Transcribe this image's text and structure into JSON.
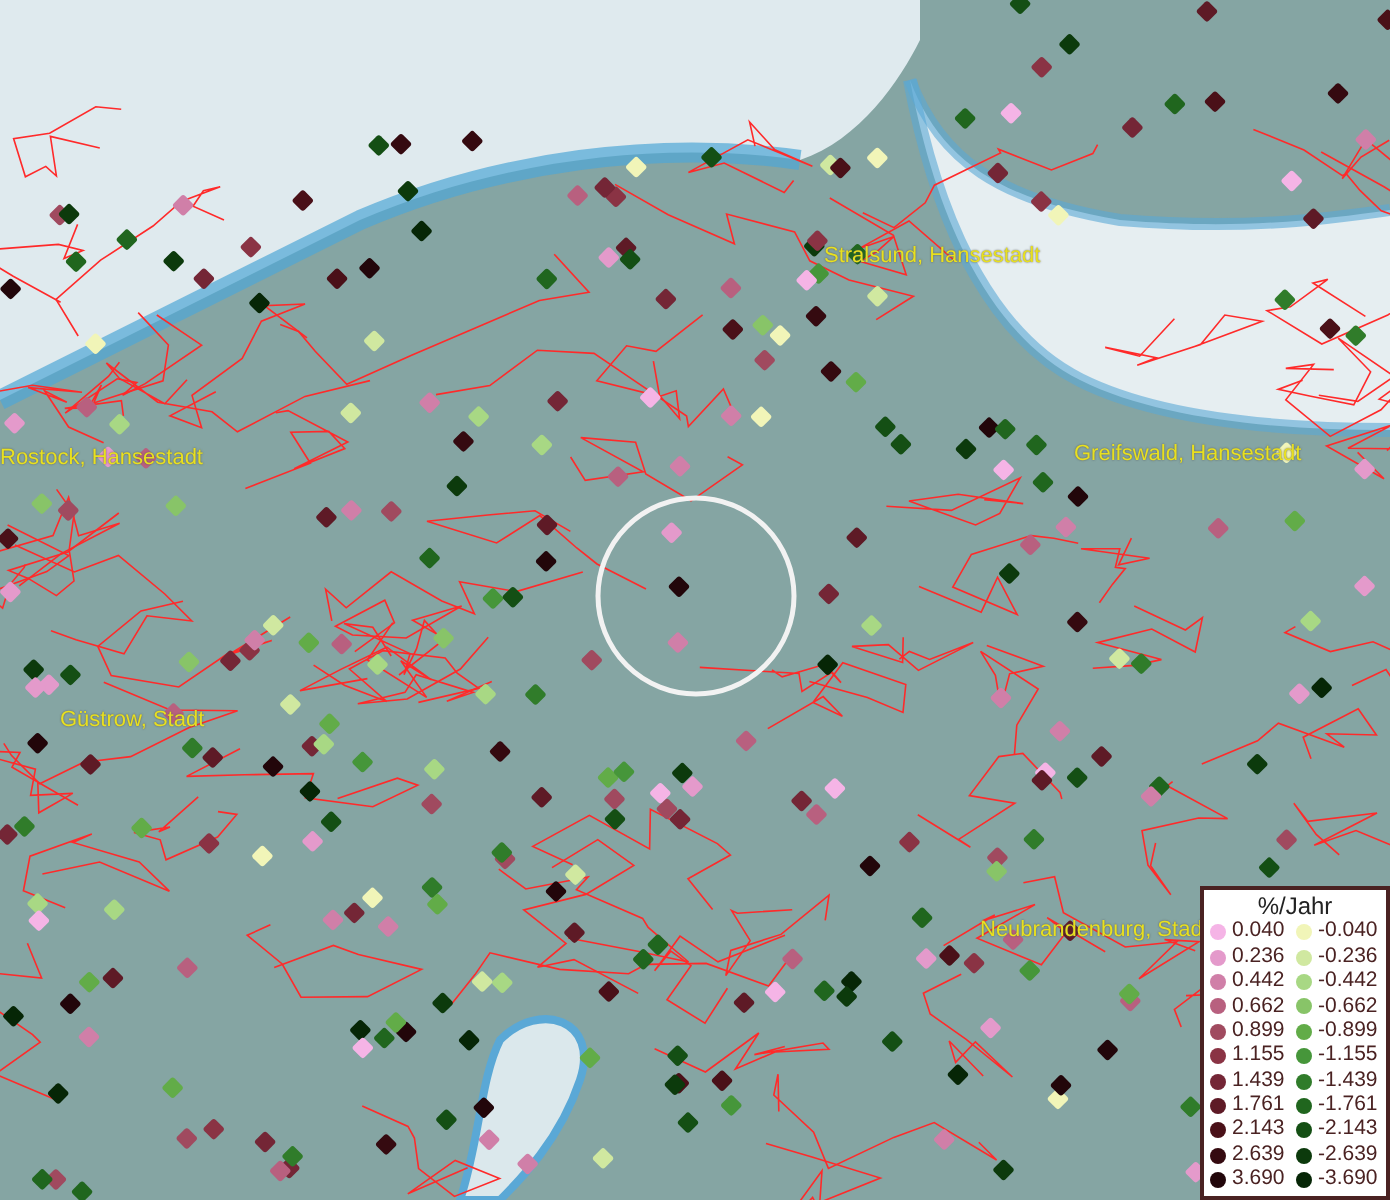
{
  "map_labels": [
    {
      "text": "Stralsund, Hansestadt"
    },
    {
      "text": "Rostock, Hansestadt"
    },
    {
      "text": "Greifswald, Hansestadt"
    },
    {
      "text": "Güstrow, Stadt"
    },
    {
      "text": "Neubrandenburg, Stad"
    }
  ],
  "legend": {
    "title": "%/Jahr",
    "positive": [
      {
        "label": "0.040",
        "color": "#f5b4e6"
      },
      {
        "label": "0.236",
        "color": "#e49acb"
      },
      {
        "label": "0.442",
        "color": "#d07fa8"
      },
      {
        "label": "0.662",
        "color": "#b8607f"
      },
      {
        "label": "0.899",
        "color": "#a04a5f"
      },
      {
        "label": "1.155",
        "color": "#8a3344"
      },
      {
        "label": "1.439",
        "color": "#742636"
      },
      {
        "label": "1.761",
        "color": "#5e1a26"
      },
      {
        "label": "2.143",
        "color": "#4a1018"
      },
      {
        "label": "2.639",
        "color": "#350a10"
      },
      {
        "label": "3.690",
        "color": "#22060a"
      }
    ],
    "negative": [
      {
        "label": "-0.040",
        "color": "#f1f5b8"
      },
      {
        "label": "-0.236",
        "color": "#d0e8a0"
      },
      {
        "label": "-0.442",
        "color": "#a8d884"
      },
      {
        "label": "-0.662",
        "color": "#88c468"
      },
      {
        "label": "-0.899",
        "color": "#62ac48"
      },
      {
        "label": "-1.155",
        "color": "#46963a"
      },
      {
        "label": "-1.439",
        "color": "#307c2a"
      },
      {
        "label": "-1.761",
        "color": "#20661e"
      },
      {
        "label": "-2.143",
        "color": "#144f14"
      },
      {
        "label": "-2.639",
        "color": "#0c3a0c"
      },
      {
        "label": "-3.690",
        "color": "#062606"
      }
    ]
  }
}
